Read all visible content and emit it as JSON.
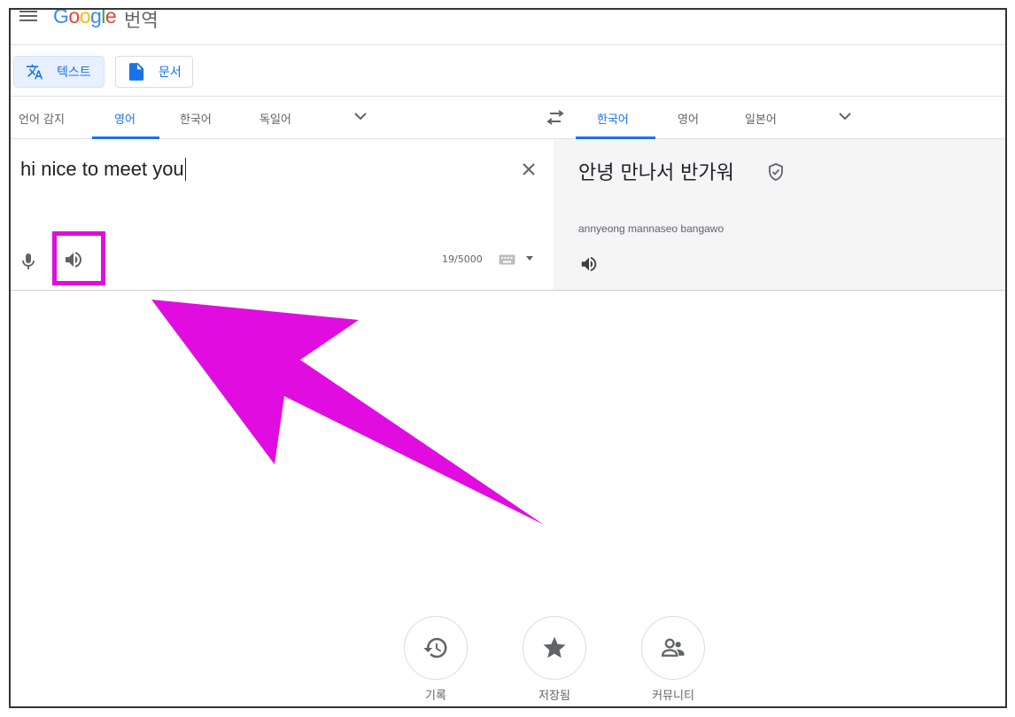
{
  "header": {
    "product_name": "번역"
  },
  "modes": {
    "text_label": "텍스트",
    "document_label": "문서"
  },
  "source_langs": [
    "언어 감지",
    "영어",
    "한국어",
    "독일어"
  ],
  "target_langs": [
    "한국어",
    "영어",
    "일본어"
  ],
  "source": {
    "text": "hi nice to meet you",
    "counter": "19/5000"
  },
  "target": {
    "text": "안녕 만나서 반가워",
    "romanization": "annyeong mannaseo bangawo"
  },
  "shortcuts": {
    "history": "기록",
    "saved": "저장됨",
    "community": "커뮤니티"
  },
  "colors": {
    "accent": "#1a73e8",
    "annotation": "#e00ce0"
  }
}
